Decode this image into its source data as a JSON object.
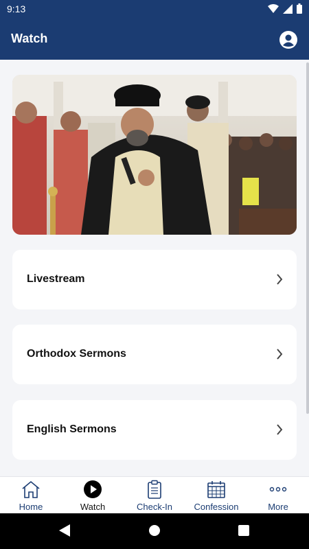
{
  "status_bar": {
    "time": "9:13"
  },
  "app_bar": {
    "title": "Watch"
  },
  "menu": [
    {
      "label": "Livestream"
    },
    {
      "label": "Orthodox Sermons"
    },
    {
      "label": "English Sermons"
    }
  ],
  "nav": [
    {
      "label": "Home",
      "icon": "home-icon",
      "active": false
    },
    {
      "label": "Watch",
      "icon": "play-circle-icon",
      "active": true
    },
    {
      "label": "Check-In",
      "icon": "clipboard-icon",
      "active": false
    },
    {
      "label": "Confession",
      "icon": "calendar-icon",
      "active": false
    },
    {
      "label": "More",
      "icon": "more-dots-icon",
      "active": false
    }
  ],
  "colors": {
    "primary": "#1b3c72",
    "background": "#f4f5f8",
    "card": "#ffffff"
  }
}
